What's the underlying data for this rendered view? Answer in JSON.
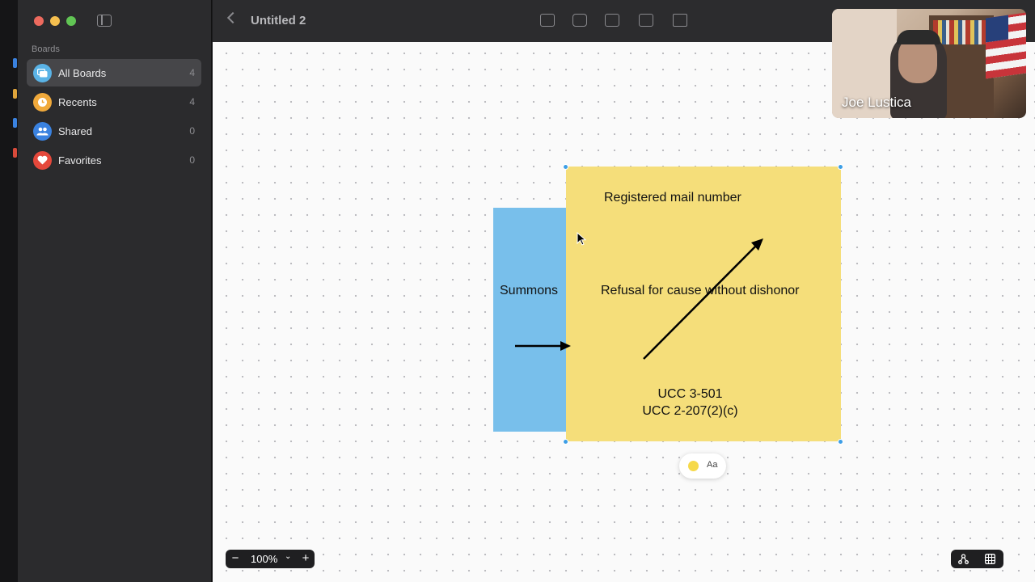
{
  "sidebar": {
    "section_label": "Boards",
    "items": [
      {
        "label": "All Boards",
        "count": "4",
        "icon": "boards-icon",
        "color": "#5ab3e6"
      },
      {
        "label": "Recents",
        "count": "4",
        "icon": "clock-icon",
        "color": "#f0a93b"
      },
      {
        "label": "Shared",
        "count": "0",
        "icon": "people-icon",
        "color": "#3a82e0"
      },
      {
        "label": "Favorites",
        "count": "0",
        "icon": "heart-icon",
        "color": "#e5483b"
      }
    ]
  },
  "toolbar": {
    "title": "Untitled 2",
    "tools": [
      "note-tool-icon",
      "shape-tool-icon",
      "text-box-tool-icon",
      "media-tool-icon",
      "folder-tool-icon"
    ]
  },
  "board": {
    "blue_note": {
      "text": "Summons",
      "color": "#78bfeb"
    },
    "yellow_note": {
      "color": "#f5de7a",
      "text_top": "Registered mail number",
      "text_middle": "Refusal for cause without dishonor",
      "text_bottom_line1": "UCC 3-501",
      "text_bottom_line2": "UCC 2-207(2)(c)"
    }
  },
  "format_pill": {
    "label": "Aa",
    "color": "#f6d94a"
  },
  "zoom": {
    "value": "100%",
    "minus": "−",
    "plus": "+",
    "chevron": "⌄"
  },
  "video": {
    "participant_name": "Joe Lustica"
  }
}
